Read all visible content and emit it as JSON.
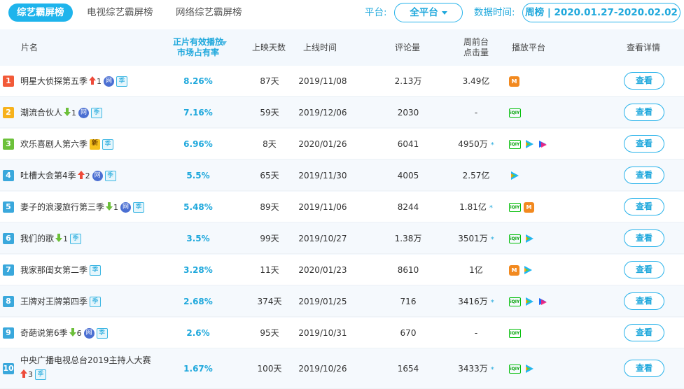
{
  "header": {
    "tabs": [
      {
        "label": "综艺霸屏榜",
        "active": true
      },
      {
        "label": "电视综艺霸屏榜",
        "active": false
      },
      {
        "label": "网络综艺霸屏榜",
        "active": false
      }
    ],
    "platform_label": "平台:",
    "platform_value": "全平台",
    "date_label": "数据时间:",
    "date_value": "周榜 | 2020.01.27-2020.02.02"
  },
  "columns": {
    "title": "片名",
    "share_line1": "正片有效播放",
    "share_line2": "市场占有率",
    "days": "上映天数",
    "release": "上线时间",
    "comments": "评论量",
    "clicks_line1": "周前台",
    "clicks_line2": "点击量",
    "platforms": "播放平台",
    "detail": "查看详情"
  },
  "colors": {
    "accent": "#1eb4ec",
    "rank1": "#f25a38",
    "rank2": "#f7b21c",
    "rank3": "#6cc13a",
    "rank_other": "#3aa8dc",
    "trend_up": "#ee4b3a",
    "trend_down": "#6cbf3a"
  },
  "rows": [
    {
      "rank": "1",
      "title": "明星大侦探第五季",
      "trend": "up",
      "trend_num": "1",
      "badges": [
        "网",
        "季"
      ],
      "share": "8.26%",
      "days": "87天",
      "release": "2019/11/08",
      "comments": "2.13万",
      "clicks": "3.49亿",
      "star": false,
      "platforms": [
        "mgtv-icon"
      ],
      "button": "查看"
    },
    {
      "rank": "2",
      "title": "潮流合伙人",
      "trend": "down",
      "trend_num": "1",
      "badges": [
        "网",
        "季"
      ],
      "share": "7.16%",
      "days": "59天",
      "release": "2019/12/06",
      "comments": "2030",
      "clicks": "-",
      "star": false,
      "platforms": [
        "iqiyi-icon"
      ],
      "button": "查看"
    },
    {
      "rank": "3",
      "title": "欢乐喜剧人第六季",
      "trend": "",
      "trend_num": "",
      "badges": [
        "新",
        "季"
      ],
      "share": "6.96%",
      "days": "8天",
      "release": "2020/01/26",
      "comments": "6041",
      "clicks": "4950万",
      "star": true,
      "platforms": [
        "iqiyi-icon",
        "tencent-video-icon",
        "youku-icon"
      ],
      "button": "查看"
    },
    {
      "rank": "4",
      "title": "吐槽大会第4季",
      "trend": "up",
      "trend_num": "2",
      "badges": [
        "网",
        "季"
      ],
      "share": "5.5%",
      "days": "65天",
      "release": "2019/11/30",
      "comments": "4005",
      "clicks": "2.57亿",
      "star": false,
      "platforms": [
        "tencent-video-icon"
      ],
      "button": "查看"
    },
    {
      "rank": "5",
      "title": "妻子的浪漫旅行第三季",
      "trend": "down",
      "trend_num": "1",
      "badges": [
        "网",
        "季"
      ],
      "share": "5.48%",
      "days": "89天",
      "release": "2019/11/06",
      "comments": "8244",
      "clicks": "1.81亿",
      "star": true,
      "platforms": [
        "iqiyi-icon",
        "mgtv-icon"
      ],
      "button": "查看"
    },
    {
      "rank": "6",
      "title": "我们的歌",
      "trend": "down",
      "trend_num": "1",
      "badges": [
        "季"
      ],
      "share": "3.5%",
      "days": "99天",
      "release": "2019/10/27",
      "comments": "1.38万",
      "clicks": "3501万",
      "star": true,
      "platforms": [
        "iqiyi-icon",
        "tencent-video-icon"
      ],
      "button": "查看"
    },
    {
      "rank": "7",
      "title": "我家那闺女第二季",
      "trend": "",
      "trend_num": "",
      "badges": [
        "季"
      ],
      "share": "3.28%",
      "days": "11天",
      "release": "2020/01/23",
      "comments": "8610",
      "clicks": "1亿",
      "star": false,
      "platforms": [
        "mgtv-icon",
        "tencent-video-icon"
      ],
      "button": "查看"
    },
    {
      "rank": "8",
      "title": "王牌对王牌第四季",
      "trend": "",
      "trend_num": "",
      "badges": [
        "季"
      ],
      "share": "2.68%",
      "days": "374天",
      "release": "2019/01/25",
      "comments": "716",
      "clicks": "3416万",
      "star": true,
      "platforms": [
        "iqiyi-icon",
        "tencent-video-icon",
        "youku-icon"
      ],
      "button": "查看"
    },
    {
      "rank": "9",
      "title": "奇葩说第6季",
      "trend": "down",
      "trend_num": "6",
      "badges": [
        "网",
        "季"
      ],
      "share": "2.6%",
      "days": "95天",
      "release": "2019/10/31",
      "comments": "670",
      "clicks": "-",
      "star": false,
      "platforms": [
        "iqiyi-icon"
      ],
      "button": "查看"
    },
    {
      "rank": "10",
      "title": "中央广播电视总台2019主持人大赛",
      "trend": "up",
      "trend_num": "3",
      "badges": [
        "季"
      ],
      "share": "1.67%",
      "days": "100天",
      "release": "2019/10/26",
      "comments": "1654",
      "clicks": "3433万",
      "star": true,
      "platforms": [
        "iqiyi-icon",
        "tencent-video-icon"
      ],
      "button": "查看"
    }
  ]
}
